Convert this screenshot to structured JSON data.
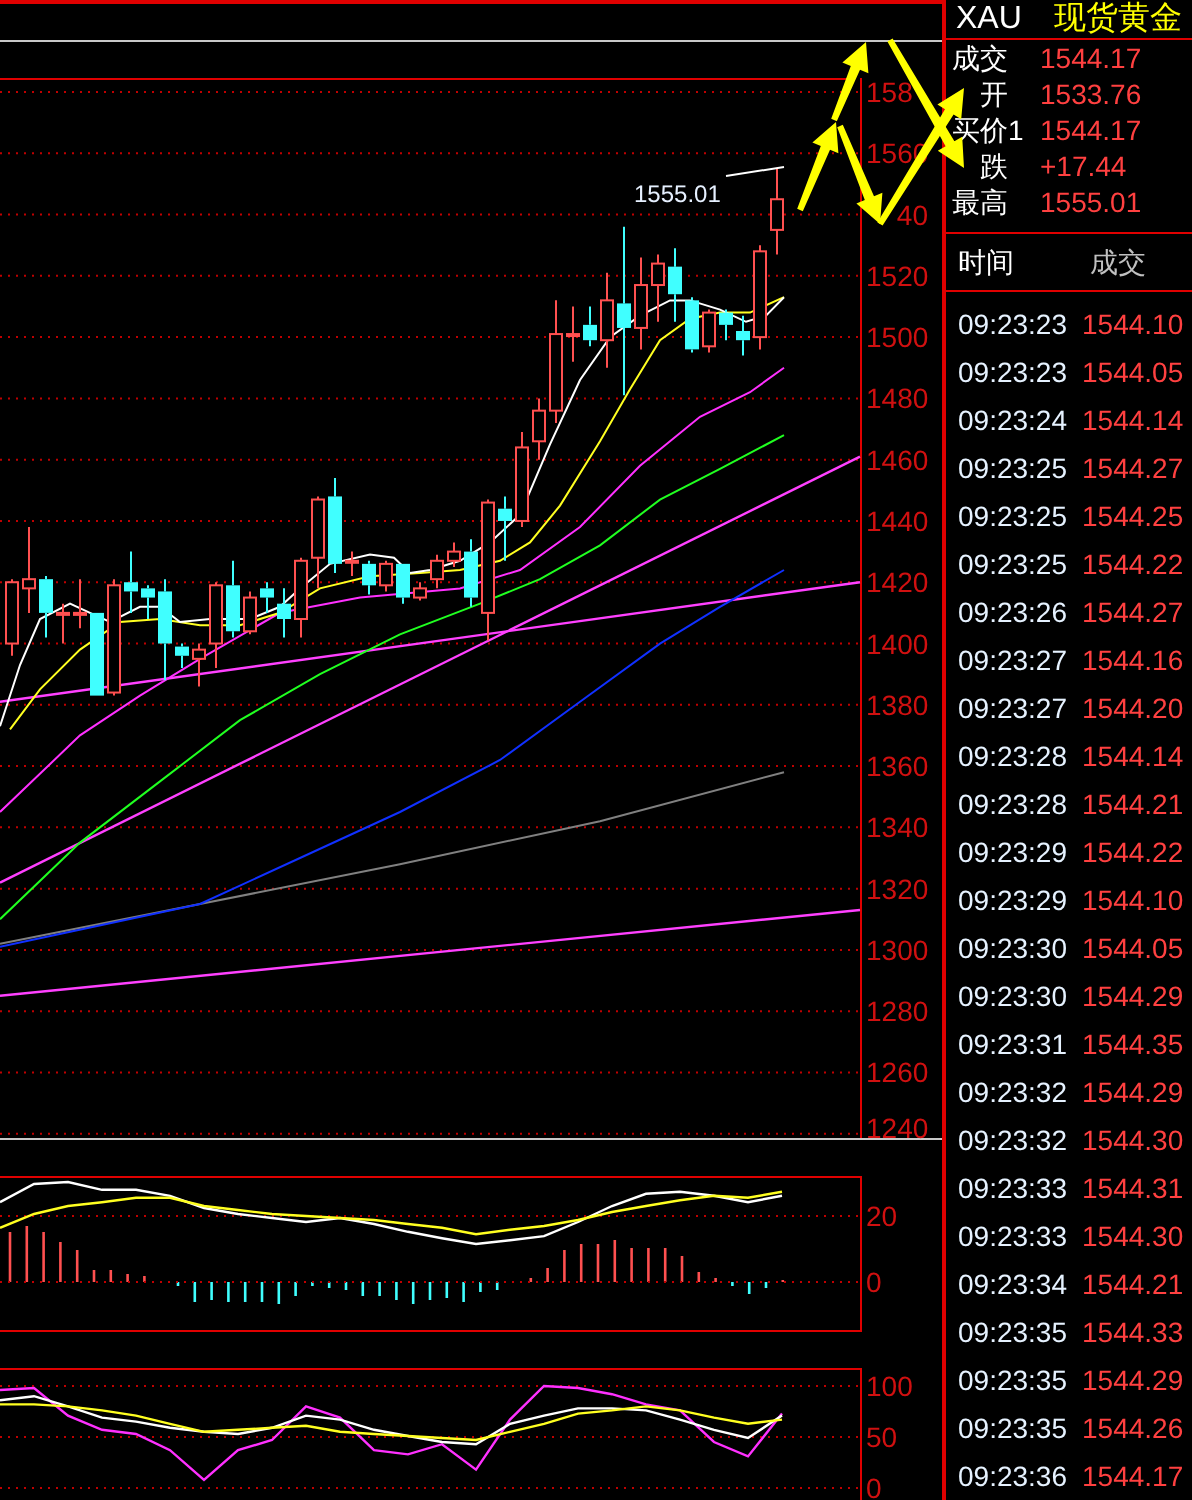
{
  "chart": {
    "price_axis_labels": [
      "158",
      "1560",
      "40",
      "1520",
      "1500",
      "1480",
      "1460",
      "1440",
      "1420",
      "1400",
      "1380",
      "1360",
      "1340",
      "1320",
      "1300",
      "1280",
      "1260",
      "1240"
    ],
    "high_label": "1555.01"
  },
  "macd": {
    "chart_data": {
      "type": "line",
      "ylim": [
        -14.5,
        32.1
      ],
      "grid": true,
      "yticks": [
        {
          "value": 20,
          "label": "20"
        },
        {
          "value": 0,
          "label": "0"
        }
      ],
      "series": [
        {
          "color": "#ffffff",
          "values": [
            24.2,
            29.7,
            30.3,
            27.9,
            27.9,
            26.1,
            22.4,
            20.6,
            19.4,
            18.2,
            19.4,
            17.6,
            15.2,
            13.3,
            11.5,
            12.7,
            13.9,
            18.2,
            23.0,
            26.7,
            27.3,
            26.1,
            24.2,
            26.1
          ]
        },
        {
          "color": "#ffff20",
          "values": [
            16.4,
            20.6,
            23.0,
            24.2,
            25.5,
            25.5,
            23.0,
            21.8,
            20.6,
            20.0,
            19.4,
            18.8,
            17.6,
            16.4,
            14.5,
            15.8,
            17.0,
            18.8,
            21.2,
            23.0,
            24.8,
            26.1,
            25.5,
            27.3
          ]
        }
      ]
    }
  },
  "kdj": {
    "chart_data": {
      "type": "line",
      "ylim": [
        0,
        117.6
      ],
      "grid": true,
      "yticks": [
        {
          "value": 100,
          "label": "100"
        },
        {
          "value": 50,
          "label": "50"
        },
        {
          "value": 0,
          "label": "0"
        }
      ],
      "series": [
        {
          "color": "#ff30ff",
          "values": [
            96,
            98,
            71,
            57,
            53,
            37,
            8,
            37,
            47,
            80,
            69,
            37,
            33,
            43,
            18,
            67,
            100,
            98,
            92,
            82,
            76,
            45,
            31,
            73
          ]
        },
        {
          "color": "#ffffff",
          "values": [
            86,
            90,
            80,
            69,
            65,
            59,
            55,
            53,
            59,
            71,
            67,
            57,
            51,
            45,
            43,
            63,
            71,
            78,
            78,
            76,
            67,
            57,
            49,
            71
          ]
        },
        {
          "color": "#ffff20",
          "values": [
            82,
            82,
            80,
            76,
            71,
            63,
            55,
            57,
            59,
            61,
            55,
            53,
            51,
            49,
            47,
            55,
            63,
            73,
            76,
            80,
            76,
            69,
            63,
            67
          ]
        }
      ]
    }
  },
  "quote": {
    "symbol": "XAU",
    "name": "现货黄金",
    "fields": [
      {
        "label": "成交",
        "value": "1544.17"
      },
      {
        "label": "开",
        "value": "1533.76"
      },
      {
        "label": "买价1",
        "value": "1544.17"
      },
      {
        "label": "跌",
        "value": "+17.44"
      },
      {
        "label": "最高",
        "value": "1555.01"
      }
    ]
  },
  "ticks": {
    "columns": [
      "时间",
      "成交"
    ],
    "rows": [
      {
        "time": "09:23:23",
        "price": "1544.10"
      },
      {
        "time": "09:23:23",
        "price": "1544.05"
      },
      {
        "time": "09:23:24",
        "price": "1544.14"
      },
      {
        "time": "09:23:25",
        "price": "1544.27"
      },
      {
        "time": "09:23:25",
        "price": "1544.25"
      },
      {
        "time": "09:23:25",
        "price": "1544.22"
      },
      {
        "time": "09:23:26",
        "price": "1544.27"
      },
      {
        "time": "09:23:27",
        "price": "1544.16"
      },
      {
        "time": "09:23:27",
        "price": "1544.20"
      },
      {
        "time": "09:23:28",
        "price": "1544.14"
      },
      {
        "time": "09:23:28",
        "price": "1544.21"
      },
      {
        "time": "09:23:29",
        "price": "1544.22"
      },
      {
        "time": "09:23:29",
        "price": "1544.10"
      },
      {
        "time": "09:23:30",
        "price": "1544.05"
      },
      {
        "time": "09:23:30",
        "price": "1544.29"
      },
      {
        "time": "09:23:31",
        "price": "1544.35"
      },
      {
        "time": "09:23:32",
        "price": "1544.29"
      },
      {
        "time": "09:23:32",
        "price": "1544.30"
      },
      {
        "time": "09:23:33",
        "price": "1544.31"
      },
      {
        "time": "09:23:33",
        "price": "1544.30"
      },
      {
        "time": "09:23:34",
        "price": "1544.21"
      },
      {
        "time": "09:23:35",
        "price": "1544.33"
      },
      {
        "time": "09:23:35",
        "price": "1544.29"
      },
      {
        "time": "09:23:35",
        "price": "1544.26"
      },
      {
        "time": "09:23:36",
        "price": "1544.17"
      }
    ]
  }
}
